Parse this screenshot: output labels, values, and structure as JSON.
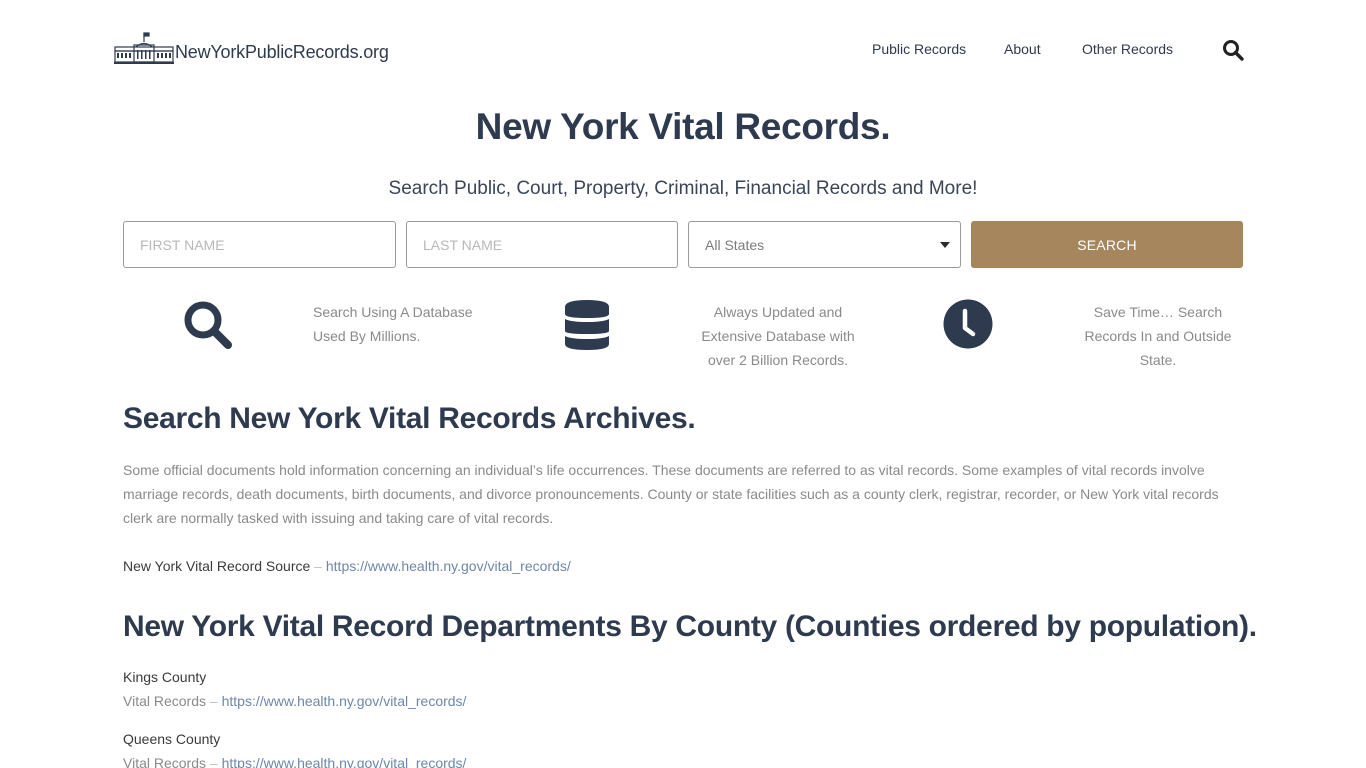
{
  "header": {
    "logo_text": "NewYorkPublicRecords.org",
    "nav": [
      {
        "label": "Public Records"
      },
      {
        "label": "About"
      },
      {
        "label": "Other Records"
      }
    ],
    "search_icon": "search-icon"
  },
  "hero": {
    "title": "New York Vital Records.",
    "subtitle": "Search Public, Court, Property, Criminal, Financial Records and More!"
  },
  "search_form": {
    "first_name_placeholder": "FIRST NAME",
    "first_name_value": "",
    "last_name_placeholder": "LAST NAME",
    "last_name_value": "",
    "state_selected": "All States",
    "button_label": "SEARCH",
    "button_color": "#a6865c"
  },
  "features": [
    {
      "icon": "search-icon",
      "text": "Search Using A Database Used By Millions."
    },
    {
      "icon": "database-icon",
      "text": "Always Updated and Extensive Database with over 2 Billion Records."
    },
    {
      "icon": "clock-icon",
      "text": "Save Time… Search Records In and Outside State."
    }
  ],
  "archives": {
    "title": "Search New York Vital Records Archives.",
    "body": "Some official documents hold information concerning an individual’s life occurrences. These documents are referred to as vital records. Some examples of vital records involve marriage records, death documents, birth documents, and divorce pronouncements. County or state facilities such as a county clerk, registrar, recorder, or New York vital records clerk are normally tasked with issuing and taking care of vital records.",
    "source_label": "New York Vital Record Source",
    "separator": " – ",
    "source_url": "https://www.health.ny.gov/vital_records/"
  },
  "departments": {
    "title": "New York Vital Record Departments By County (Counties ordered by population).",
    "counties": [
      {
        "name": "Kings County",
        "label": "Vital Records",
        "url": "https://www.health.ny.gov/vital_records/"
      },
      {
        "name": "Queens County",
        "label": "Vital Records",
        "url": "https://www.health.ny.gov/vital_records/"
      }
    ]
  },
  "colors": {
    "text_dark": "#2e3a4e",
    "accent": "#a6865c",
    "link": "#6d87a8"
  }
}
